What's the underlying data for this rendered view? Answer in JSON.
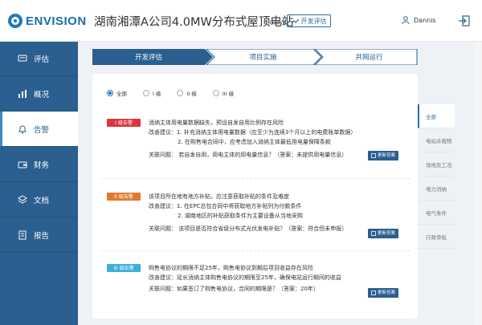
{
  "header": {
    "brand": "ENVISION",
    "site_title": "湖南湘潭A公司4.0MW分布式屋顶电站",
    "capacity": "4.0MW",
    "stage_button": "开发评估",
    "user_name": "Dannis"
  },
  "sidebar": {
    "items": [
      {
        "label": "评估",
        "icon": "chat-icon"
      },
      {
        "label": "概况",
        "icon": "bar-chart-icon"
      },
      {
        "label": "告警",
        "icon": "bell-icon",
        "active": true
      },
      {
        "label": "财务",
        "icon": "wallet-icon"
      },
      {
        "label": "文档",
        "icon": "layers-icon"
      },
      {
        "label": "报告",
        "icon": "report-icon"
      }
    ]
  },
  "stepper": {
    "steps": [
      "开发评估",
      "项目实施",
      "并网运行"
    ],
    "active_index": 0
  },
  "filters": {
    "options": [
      "全部",
      "I 级",
      "II 级",
      "III 级"
    ],
    "selected_index": 0
  },
  "risks": [
    {
      "badge": "I 级告警",
      "badge_color": "#d9363e",
      "title": "消纳主体用电量数据缺失，预设自发自用比例存在风险",
      "suggest_label": "改善建议：",
      "suggestions": [
        "1. 补充消纳主体用电量数据（应至少为连续3个月以上的电费账单数据）",
        "2. 在购售电合同中，应考虑加入消纳主体最低用电量保障条款"
      ],
      "question": "关联问题：  若自发自用，用电主体的用电量信息？（答案：未提供用电量信息）",
      "button": "更新答案"
    },
    {
      "badge": "II 级告警",
      "badge_color": "#e07a32",
      "title": "该项目所在地有地方补贴，应注意获取补贴的条件及难度",
      "suggest_label": "改善建议：",
      "suggestions": [
        "1. 在EPC总包合同中将获取地方补贴列为付款条件",
        "2. 湖南地区的补贴获取条件为主要设备从当地采购"
      ],
      "question": "关联问题：  该项目是否符合省级分布式光伏发电补贴？（答案：符合但未申报）",
      "button": "更新答案"
    },
    {
      "badge": "III 级告警",
      "badge_color": "#3bb0d9",
      "title": "购售电协议的期限不足25年，购售电协议到期后项目收益存在风险",
      "suggest_label": "改善建议：延长消纳主体购售电协议的期限至25年，确保电站运行期间的收益",
      "suggestions": [],
      "question": "关联问题：如果签订了购售电协议，合同的期限是？（答案：20年）",
      "button": "更新答案"
    }
  ],
  "categories": {
    "items": [
      "全部",
      "电站杀载物",
      "场地及工况",
      "电力消纳",
      "电气条件",
      "行政审批"
    ],
    "active_index": 0
  },
  "colors": {
    "primary": "#2a5f8f",
    "accent": "#1a7bbd"
  }
}
